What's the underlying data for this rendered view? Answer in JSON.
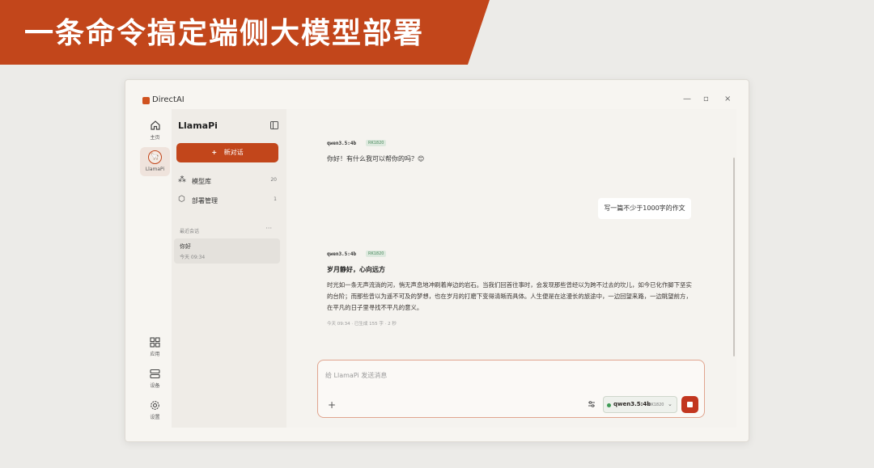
{
  "banner": {
    "title": "一条命令搞定端侧大模型部署"
  },
  "window": {
    "app_name": "DirectAI",
    "controls": {
      "minimize": "—",
      "maximize": "▫",
      "close": "×"
    }
  },
  "rail": {
    "home_label": "主页",
    "llamapi_label": "LlamaPi",
    "apps_label": "应用",
    "devices_label": "设备",
    "settings_label": "设置"
  },
  "panel": {
    "title": "LlamaPi",
    "new_chat_label": "新对话",
    "nav": [
      {
        "label": "模型库",
        "count": "20",
        "icon": "cubes-icon"
      },
      {
        "label": "部署管理",
        "count": "1",
        "icon": "box-icon"
      }
    ],
    "recent_label": "最近会话",
    "recent_more": "···",
    "conversations": [
      {
        "title": "你好",
        "time": "今天 09:34"
      }
    ]
  },
  "chat": {
    "messages": [
      {
        "role": "assistant",
        "model": "qwen3.5:4b",
        "chip": "RK1820",
        "text": "你好！有什么我可以帮你的吗？😊"
      },
      {
        "role": "user",
        "text": "写一篇不少于1000字的作文"
      },
      {
        "role": "assistant",
        "model": "qwen3.5:4b",
        "chip": "RK1820",
        "title": "岁月静好，心向远方",
        "text": "时光如一条无声流淌的河，悄无声息地冲刷着岸边的岩石。当我们回首往事时，会发现那些曾经以为跨不过去的坎儿，如今已化作脚下坚实的台阶；而那些曾以为遥不可及的梦想，也在岁月的打磨下变得清晰而具体。人生便是在这漫长的旅途中，一边回望来路，一边眺望前方，在平凡的日子里寻找不平凡的意义。",
        "meta": "今天 09:34 · 已生成 155 字 · 2 秒"
      }
    ]
  },
  "input": {
    "placeholder": "给 LlamaPi 发送消息",
    "model_name": "qwen3.5:4b",
    "model_chip": "RK1820"
  },
  "colors": {
    "accent": "#c2461b",
    "status_green": "#3e9b55"
  }
}
